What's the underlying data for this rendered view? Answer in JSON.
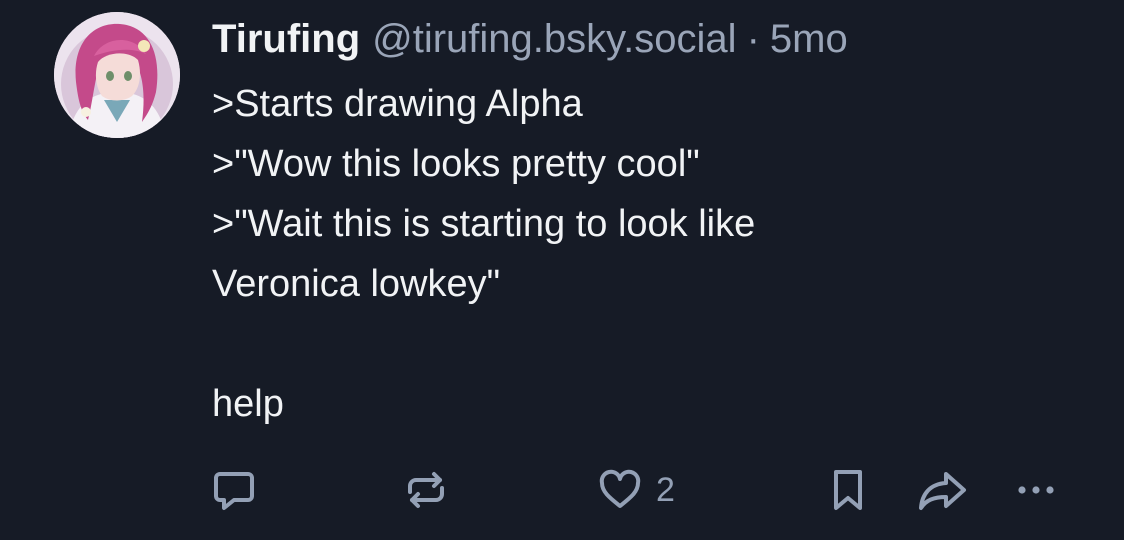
{
  "post": {
    "author": {
      "display_name": "Tirufing",
      "handle": "@tirufing.bsky.social"
    },
    "separator": "·",
    "time_ago": "5mo",
    "lines": [
      ">Starts drawing Alpha",
      ">\"Wow this looks pretty cool\"",
      ">\"Wait this is starting to look like",
      "Veronica lowkey\"",
      "",
      "help"
    ],
    "likes": "2"
  },
  "icons": {
    "reply": "reply-icon",
    "repost": "repost-icon",
    "like": "heart-icon",
    "bookmark": "bookmark-icon",
    "share": "share-icon",
    "more": "more-icon"
  },
  "colors": {
    "background": "#161b26",
    "text": "#f1f3f5",
    "muted": "#9aa5b8",
    "icon": "#93a0b5"
  }
}
